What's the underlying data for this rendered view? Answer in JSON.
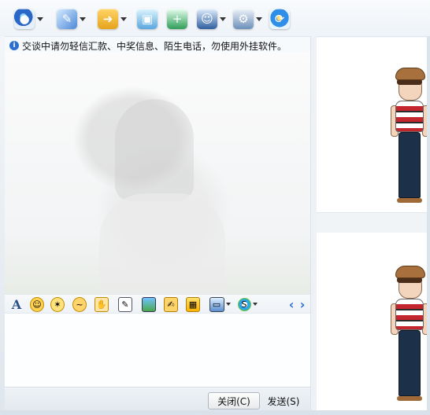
{
  "toolbar": {
    "items": [
      {
        "icon": "webcam-icon",
        "has_menu": true
      },
      {
        "icon": "microphone-icon",
        "has_menu": true
      },
      {
        "icon": "folder-transfer-icon",
        "has_menu": true
      },
      {
        "icon": "screenshot-window-icon",
        "has_menu": false
      },
      {
        "icon": "create-group-icon",
        "has_menu": false
      },
      {
        "icon": "user-profile-icon",
        "has_menu": true
      },
      {
        "icon": "app-settings-icon",
        "has_menu": true
      },
      {
        "icon": "share-refresh-icon",
        "has_menu": false
      }
    ]
  },
  "notice": {
    "text": "交谈中请勿轻信汇款、中奖信息、陌生电话，勿使用外挂软件。"
  },
  "format_bar": {
    "font_label": "A",
    "items": [
      "font-icon",
      "emoji-smile-icon",
      "magic-face-icon",
      "shake-icon",
      "gesture-icon",
      "edit-doodle-icon",
      "image-icon",
      "doodle-icon",
      "gift-icon",
      "screen-capture-icon",
      "music-icon",
      "prev-icon",
      "next-icon"
    ],
    "prev_label": "‹",
    "next_label": "›"
  },
  "buttons": {
    "close_label": "关闭(C)",
    "send_label": "发送(S)"
  },
  "colors": {
    "accent": "#2c6fd1",
    "toolbar_bg": "#f9fbfd",
    "window_edge": "#dbe3eb"
  }
}
